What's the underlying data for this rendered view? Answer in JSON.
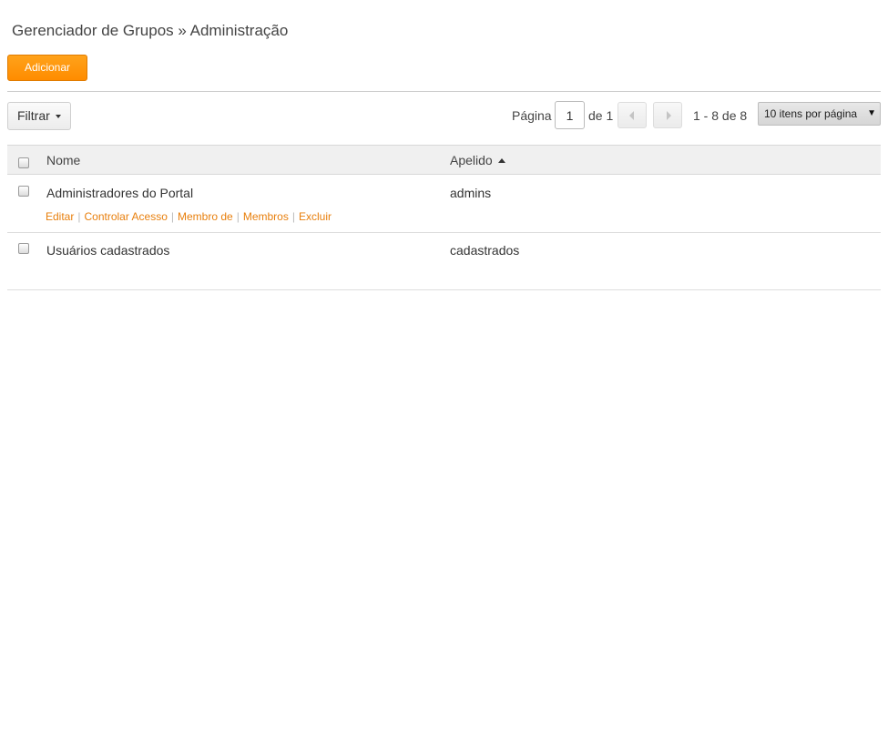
{
  "breadcrumb": {
    "text": "Gerenciador de Grupos » Administração"
  },
  "toolbar": {
    "add_label": "Adicionar",
    "filter_label": "Filtrar"
  },
  "pager": {
    "page_label": "Página",
    "current_page": "1",
    "of_label": "de 1",
    "range_text": "1 - 8 de 8",
    "per_page_selected": "10 itens por página"
  },
  "table": {
    "columns": [
      {
        "label": "Nome"
      },
      {
        "label": "Apelido",
        "sorted": "ascending"
      }
    ],
    "rows": [
      {
        "name": "Administradores do Portal",
        "alias": "admins",
        "actions": [
          "Editar",
          "Controlar Acesso",
          "Membro de",
          "Membros",
          "Excluir"
        ]
      },
      {
        "name": "Usuários cadastrados",
        "alias": "cadastrados"
      }
    ]
  },
  "colors": {
    "accent": "#ff8c00",
    "link": "#e87f0c"
  }
}
